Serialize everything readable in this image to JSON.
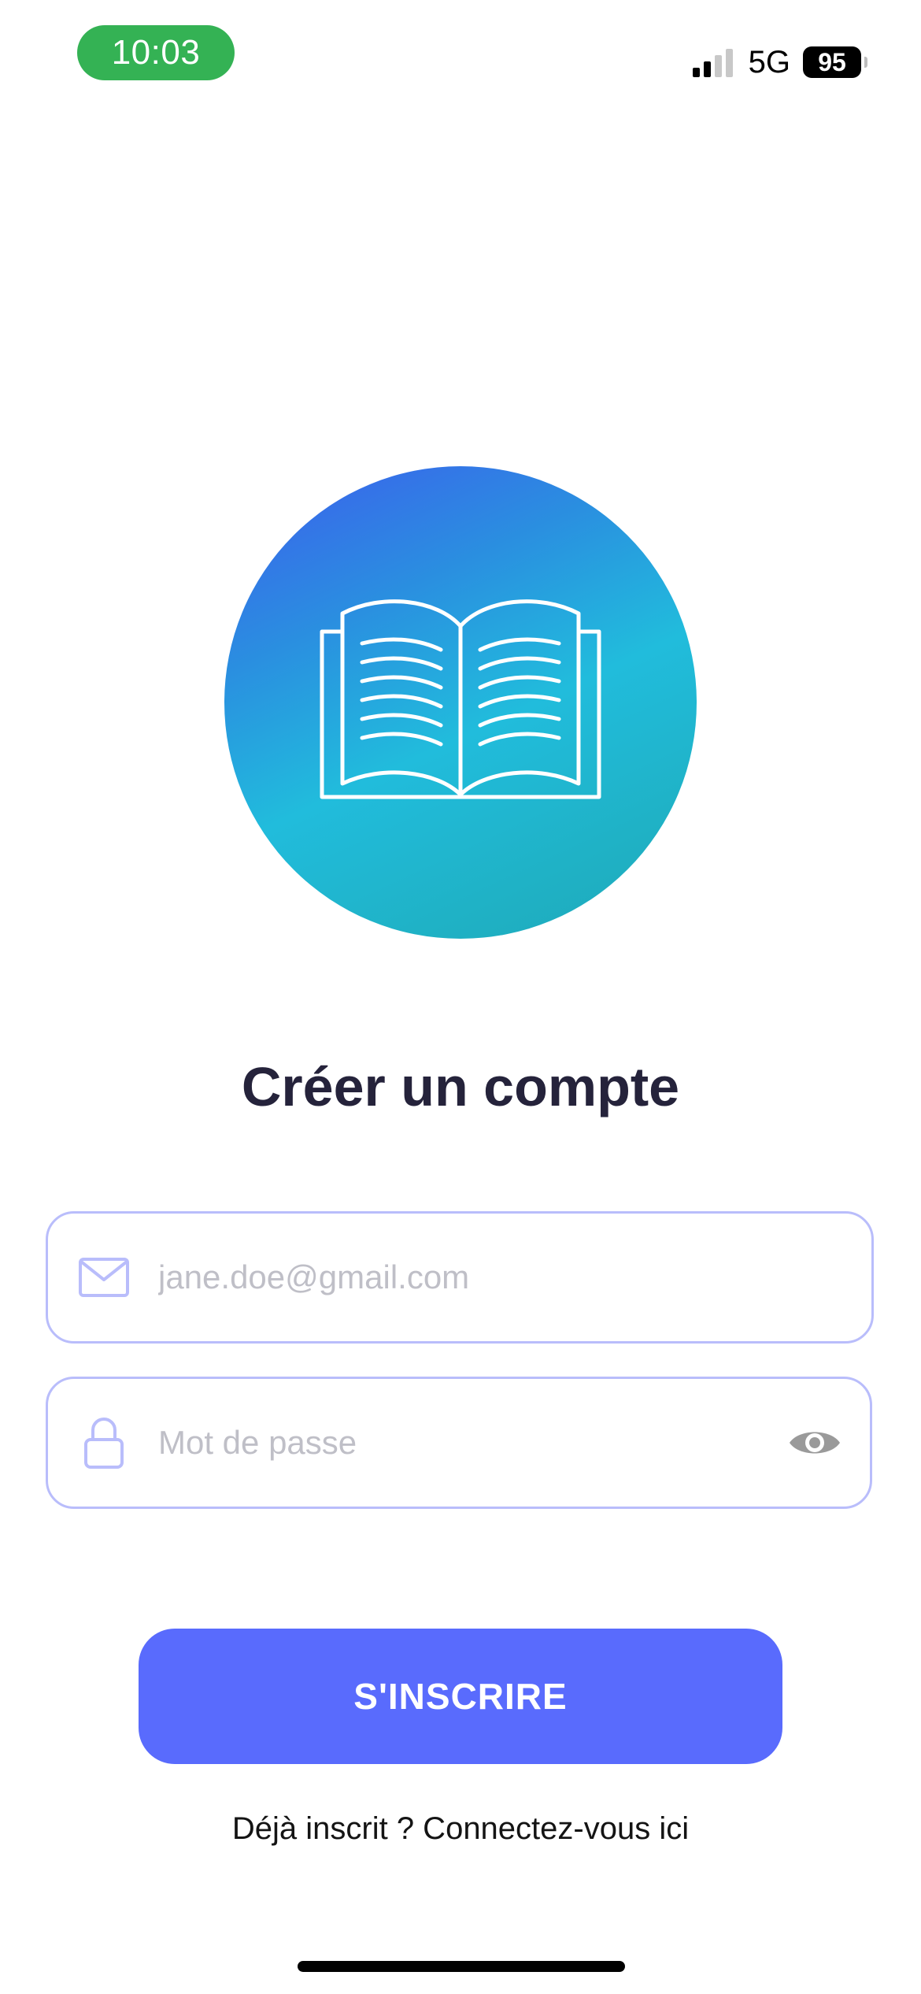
{
  "status_bar": {
    "time": "10:03",
    "network": "5G",
    "battery": "95"
  },
  "logo": {
    "icon": "open-book-icon",
    "gradient_colors": [
      "#3d5ded",
      "#21bcdc",
      "#1ea8b8"
    ]
  },
  "title": "Créer un compte",
  "form": {
    "email": {
      "icon": "envelope-icon",
      "placeholder": "jane.doe@gmail.com",
      "value": ""
    },
    "password": {
      "icon": "lock-icon",
      "placeholder": "Mot de passe",
      "value": "",
      "toggle_icon": "eye-icon"
    },
    "submit_label": "S'INSCRIRE"
  },
  "login_prompt": "Déjà inscrit ? Connectez-vous ici",
  "colors": {
    "accent": "#596bfd",
    "field_border": "#b9bdfb",
    "title": "#25233b",
    "time_pill": "#34b254"
  }
}
